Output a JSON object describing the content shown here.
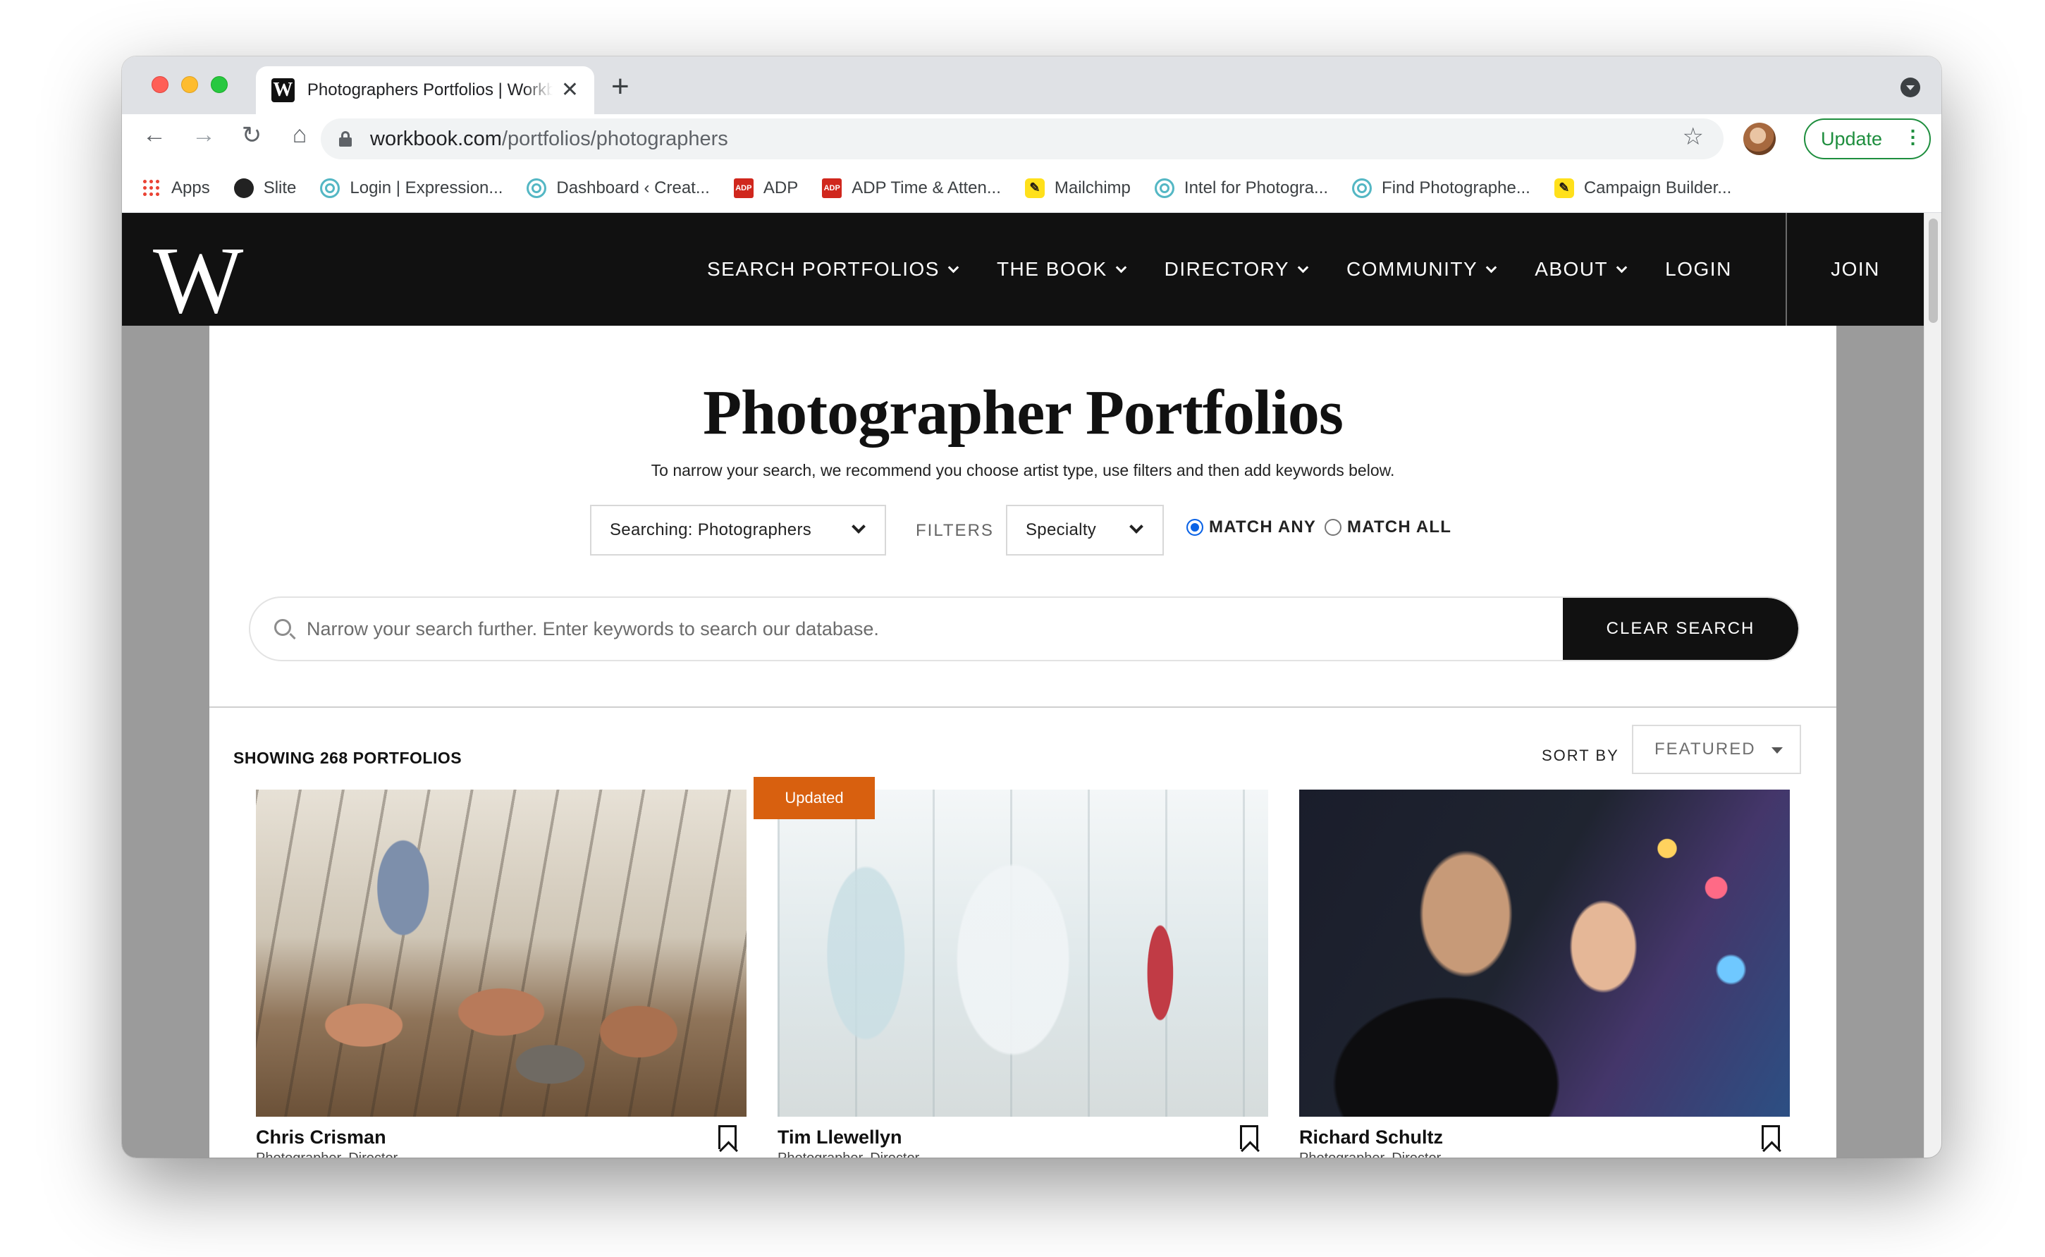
{
  "browser": {
    "tab_title": "Photographers Portfolios | Workbook",
    "tab_close": "✕",
    "new_tab": "+",
    "url_host": "workbook.com",
    "url_path": "/portfolios/photographers",
    "update_label": "Update",
    "favicon_letter": "W"
  },
  "bookmarks": [
    {
      "label": "Apps",
      "icon": "apps-grid-icon"
    },
    {
      "label": "Slite",
      "icon": "slite-icon"
    },
    {
      "label": "Login | Expression...",
      "icon": "expression-icon"
    },
    {
      "label": "Dashboard ‹ Creat...",
      "icon": "dashboard-icon"
    },
    {
      "label": "ADP",
      "icon": "adp-icon"
    },
    {
      "label": "ADP Time & Atten...",
      "icon": "adp-icon"
    },
    {
      "label": "Mailchimp",
      "icon": "mailchimp-icon"
    },
    {
      "label": "Intel for Photogra...",
      "icon": "intel-icon"
    },
    {
      "label": "Find Photographe...",
      "icon": "find-icon"
    },
    {
      "label": "Campaign Builder...",
      "icon": "mailchimp-icon"
    }
  ],
  "site": {
    "logo": "W",
    "nav": [
      "SEARCH PORTFOLIOS",
      "THE BOOK",
      "DIRECTORY",
      "COMMUNITY",
      "ABOUT",
      "LOGIN"
    ],
    "join": "JOIN"
  },
  "page": {
    "title": "Photographer Portfolios",
    "subtitle": "To narrow your search, we recommend you choose artist type, use filters and then add keywords below.",
    "searching_select": "Searching: Photographers",
    "filters_label": "FILTERS",
    "specialty_select": "Specialty",
    "match_any": "MATCH ANY",
    "match_all": "MATCH ALL",
    "match_selected": "any",
    "search_placeholder": "Narrow your search further. Enter keywords to search our database.",
    "clear_search": "CLEAR SEARCH",
    "showing": "SHOWING 268 PORTFOLIOS",
    "sort_by": "SORT BY",
    "sort_value": "FEATURED"
  },
  "cards": [
    {
      "name": "Chris Crisman",
      "role": "Photographer, Director",
      "badge": ""
    },
    {
      "name": "Tim Llewellyn",
      "role": "Photographer, Director",
      "badge": "Updated"
    },
    {
      "name": "Richard Schultz",
      "role": "Photographer, Director",
      "badge": ""
    }
  ],
  "colors": {
    "nav_bg": "#111111",
    "badge": "#d8600f",
    "update_green": "#1e8e3e",
    "radio_blue": "#0b63e6"
  }
}
